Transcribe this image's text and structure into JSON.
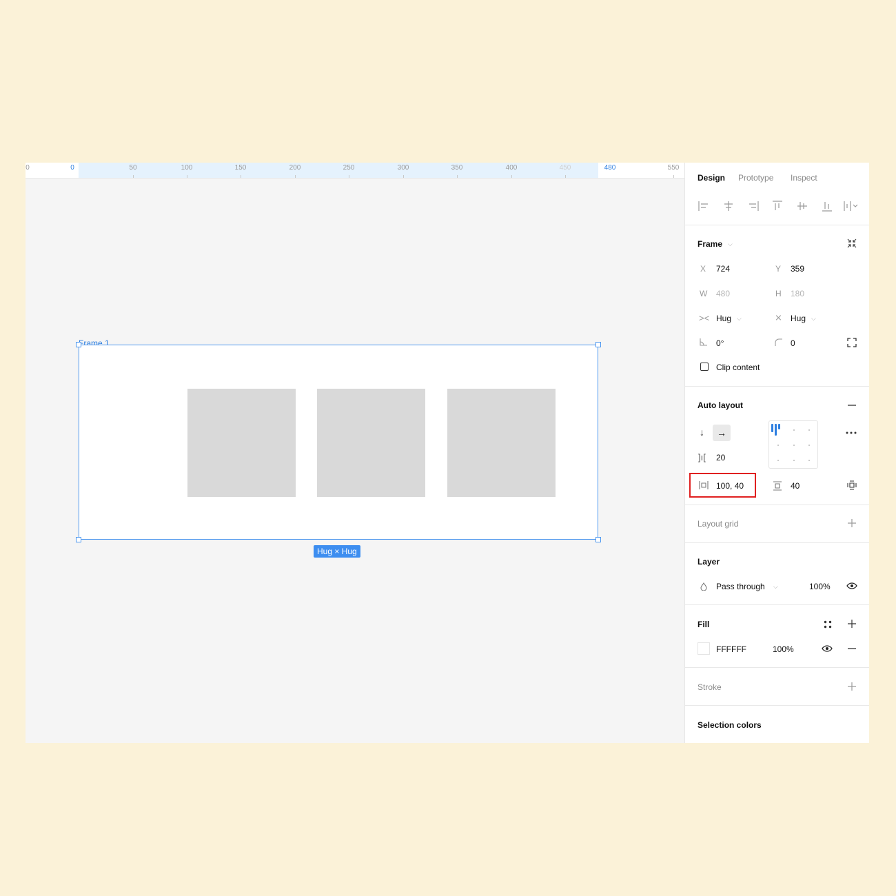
{
  "ruler": {
    "ticks": [
      "0",
      "0",
      "50",
      "100",
      "150",
      "200",
      "250",
      "300",
      "350",
      "400",
      "450",
      "480",
      "550"
    ]
  },
  "canvas": {
    "frame_label": "Frame 1",
    "size_badge": "Hug × Hug"
  },
  "panel": {
    "tabs": [
      "Design",
      "Prototype",
      "Inspect"
    ],
    "alignment_icons": [
      "align-left-icon",
      "align-horizontal-center-icon",
      "align-right-icon",
      "align-top-icon",
      "align-vertical-center-icon",
      "align-bottom-icon",
      "distribute-icon"
    ],
    "frame": {
      "title": "Frame",
      "x_label": "X",
      "x": "724",
      "y_label": "Y",
      "y": "359",
      "w_label": "W",
      "w": "480",
      "h_label": "H",
      "h": "180",
      "h_resizing": "Hug",
      "v_resizing": "Hug",
      "rotation": "0°",
      "radius": "0",
      "clip_content": "Clip content"
    },
    "auto_layout": {
      "title": "Auto layout",
      "spacing": "20",
      "padding_horizontal": "100, 40",
      "padding_vertical": "40",
      "highlight_color": "#e02020"
    },
    "layout_grid": {
      "title": "Layout grid"
    },
    "layer": {
      "title": "Layer",
      "blend": "Pass through",
      "opacity": "100%"
    },
    "fill": {
      "title": "Fill",
      "hex": "FFFFFF",
      "opacity": "100%",
      "swatch_color": "#FFFFFF"
    },
    "stroke": {
      "title": "Stroke"
    },
    "selection_colors": {
      "title": "Selection colors"
    }
  },
  "colors": {
    "accent": "#2e7fe0",
    "background": "#fbf2d8",
    "child_fill": "#d9d9d9"
  }
}
